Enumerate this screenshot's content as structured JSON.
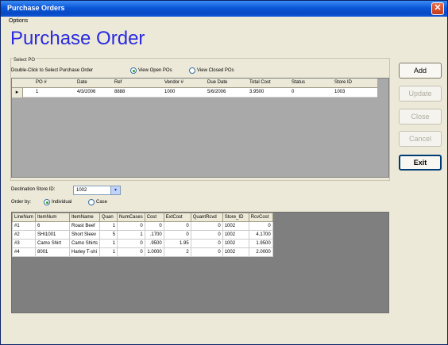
{
  "window": {
    "title": "Purchase Orders",
    "close_glyph": "✕"
  },
  "menu": {
    "options": "Options"
  },
  "heading": "Purchase Order",
  "select_po": {
    "group_label": "Select PO",
    "instructions": "Double-Click to Select Purchase Order",
    "view_open": "View Open POs",
    "view_closed": "View Closed POs",
    "selected_view": "open"
  },
  "po_grid": {
    "columns": [
      "PO #",
      "Date",
      "Ref",
      "Vendor #",
      "Due Date",
      "Total Cost",
      "Status",
      "Store ID"
    ],
    "rows": [
      [
        "1",
        "4/3/2006",
        "8888",
        "1000",
        "5/6/2006",
        "3.9500",
        "0",
        "1003"
      ]
    ],
    "row_pointer": "▸"
  },
  "buttons": {
    "add": "Add",
    "update": "Update",
    "close": "Close",
    "cancel": "Cancel",
    "exit": "Exit"
  },
  "destination": {
    "label": "Destination Store ID:",
    "value": "1002",
    "arrow": "▾"
  },
  "order_by": {
    "label": "Order by:",
    "individual": "Individual",
    "case": "Case",
    "selected": "individual"
  },
  "line_grid": {
    "columns": [
      "LineNum",
      "ItemNum",
      "ItemName",
      "Quan",
      "NumCases",
      "Cost",
      "ExtCost",
      "QuantRcvd",
      "Store_ID",
      "RcvCost"
    ],
    "rows": [
      [
        "#1",
        "6",
        "Roast Beef",
        "1",
        "0",
        "0",
        "0",
        "0",
        "1002",
        "0"
      ],
      [
        "#2",
        "SHI1001",
        "Short Sleev",
        "5",
        "1",
        ".1700",
        "0",
        "0",
        "1002",
        "4.1700"
      ],
      [
        "#3",
        "Camo Shirt",
        "Camo Shirts",
        "1",
        "0",
        ".9500",
        "1.95",
        "0",
        "1002",
        "1.9500"
      ],
      [
        "#4",
        "8001",
        "Harley T-shi",
        "1",
        "0",
        "1.0000",
        "2",
        "0",
        "1002",
        "2.0000"
      ]
    ]
  }
}
